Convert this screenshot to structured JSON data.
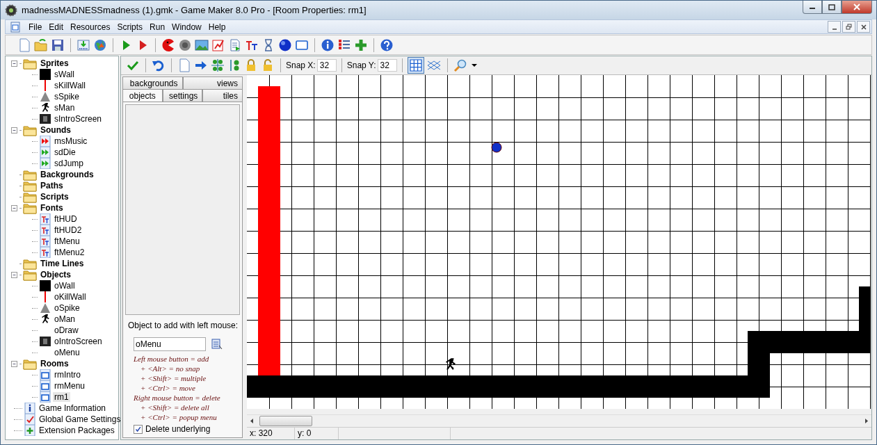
{
  "window": {
    "title": "madnessMADNESSmadness (1).gmk - Game Maker 8.0 Pro - [Room Properties: rm1]"
  },
  "menu": [
    {
      "label": "File"
    },
    {
      "label": "Edit"
    },
    {
      "label": "Resources"
    },
    {
      "label": "Scripts"
    },
    {
      "label": "Run"
    },
    {
      "label": "Window"
    },
    {
      "label": "Help"
    }
  ],
  "tree": [
    {
      "label": "Sprites",
      "kind": "folder",
      "expanded": true,
      "selected": false,
      "children": [
        {
          "label": "sWall",
          "kind": "block",
          "selected": false
        },
        {
          "label": "sKillWall",
          "kind": "line",
          "selected": false
        },
        {
          "label": "sSpike",
          "kind": "spike",
          "selected": false
        },
        {
          "label": "sMan",
          "kind": "man",
          "selected": false
        },
        {
          "label": "sIntroScreen",
          "kind": "screen",
          "selected": false
        }
      ]
    },
    {
      "label": "Sounds",
      "kind": "folder",
      "expanded": true,
      "selected": false,
      "children": [
        {
          "label": "msMusic",
          "kind": "music",
          "selected": false
        },
        {
          "label": "sdDie",
          "kind": "sound",
          "selected": false
        },
        {
          "label": "sdJump",
          "kind": "sound",
          "selected": false
        }
      ]
    },
    {
      "label": "Backgrounds",
      "kind": "folder",
      "selected": false
    },
    {
      "label": "Paths",
      "kind": "folder",
      "selected": false
    },
    {
      "label": "Scripts",
      "kind": "folder",
      "selected": false
    },
    {
      "label": "Fonts",
      "kind": "folder",
      "expanded": true,
      "selected": false,
      "children": [
        {
          "label": "ftHUD",
          "kind": "font",
          "selected": false
        },
        {
          "label": "ftHUD2",
          "kind": "font",
          "selected": false
        },
        {
          "label": "ftMenu",
          "kind": "font",
          "selected": false
        },
        {
          "label": "ftMenu2",
          "kind": "font",
          "selected": false
        }
      ]
    },
    {
      "label": "Time Lines",
      "kind": "folder",
      "selected": false
    },
    {
      "label": "Objects",
      "kind": "folder",
      "expanded": true,
      "selected": false,
      "children": [
        {
          "label": "oWall",
          "kind": "block",
          "selected": false
        },
        {
          "label": "oKillWall",
          "kind": "line",
          "selected": false
        },
        {
          "label": "oSpike",
          "kind": "spike",
          "selected": false
        },
        {
          "label": "oMan",
          "kind": "man",
          "selected": false
        },
        {
          "label": "oDraw",
          "kind": "plain",
          "selected": false
        },
        {
          "label": "oIntroScreen",
          "kind": "screen",
          "selected": false
        },
        {
          "label": "oMenu",
          "kind": "plain",
          "selected": false
        }
      ]
    },
    {
      "label": "Rooms",
      "kind": "folder",
      "expanded": true,
      "selected": false,
      "children": [
        {
          "label": "rmIntro",
          "kind": "room",
          "selected": false
        },
        {
          "label": "rmMenu",
          "kind": "room",
          "selected": false
        },
        {
          "label": "rm1",
          "kind": "room",
          "selected": true
        }
      ]
    },
    {
      "label": "Game Information",
      "kind": "info",
      "selected": false
    },
    {
      "label": "Global Game Settings",
      "kind": "settings",
      "selected": false
    },
    {
      "label": "Extension Packages",
      "kind": "extension",
      "selected": false
    }
  ],
  "room_toolbar": {
    "snaps": [
      {
        "label": "Snap X:",
        "value": "32"
      },
      {
        "label": "Snap Y:",
        "value": "32"
      }
    ],
    "toggles": [
      {
        "kind": "grid",
        "selected": true
      },
      {
        "kind": "isometric",
        "selected": false
      }
    ]
  },
  "tab_rows": [
    {
      "tabs": [
        {
          "label": "backgrounds",
          "selected": false
        },
        {
          "label": "views",
          "selected": false
        }
      ]
    },
    {
      "tabs": [
        {
          "label": "objects",
          "selected": true
        },
        {
          "label": "settings",
          "selected": false
        },
        {
          "label": "tiles",
          "selected": false
        }
      ]
    }
  ],
  "object_picker": {
    "label": "Object to add with left mouse:",
    "value": "oMenu"
  },
  "hints": [
    {
      "kind": "heading",
      "text": "Left mouse button = add"
    },
    {
      "kind": "modifier",
      "text": "+ <Alt> = no snap"
    },
    {
      "kind": "modifier",
      "text": "+ <Shift> = multiple"
    },
    {
      "kind": "modifier",
      "text": "+ <Ctrl> = move"
    },
    {
      "kind": "heading",
      "text": "Right mouse button = delete"
    },
    {
      "kind": "modifier",
      "text": "+ <Shift> = delete all"
    },
    {
      "kind": "modifier",
      "text": "+ <Ctrl> = popup menu"
    }
  ],
  "delete_underlying": {
    "label": "Delete underlying",
    "checked": true
  },
  "status_bar": [
    "x: 320",
    "y: 0"
  ]
}
